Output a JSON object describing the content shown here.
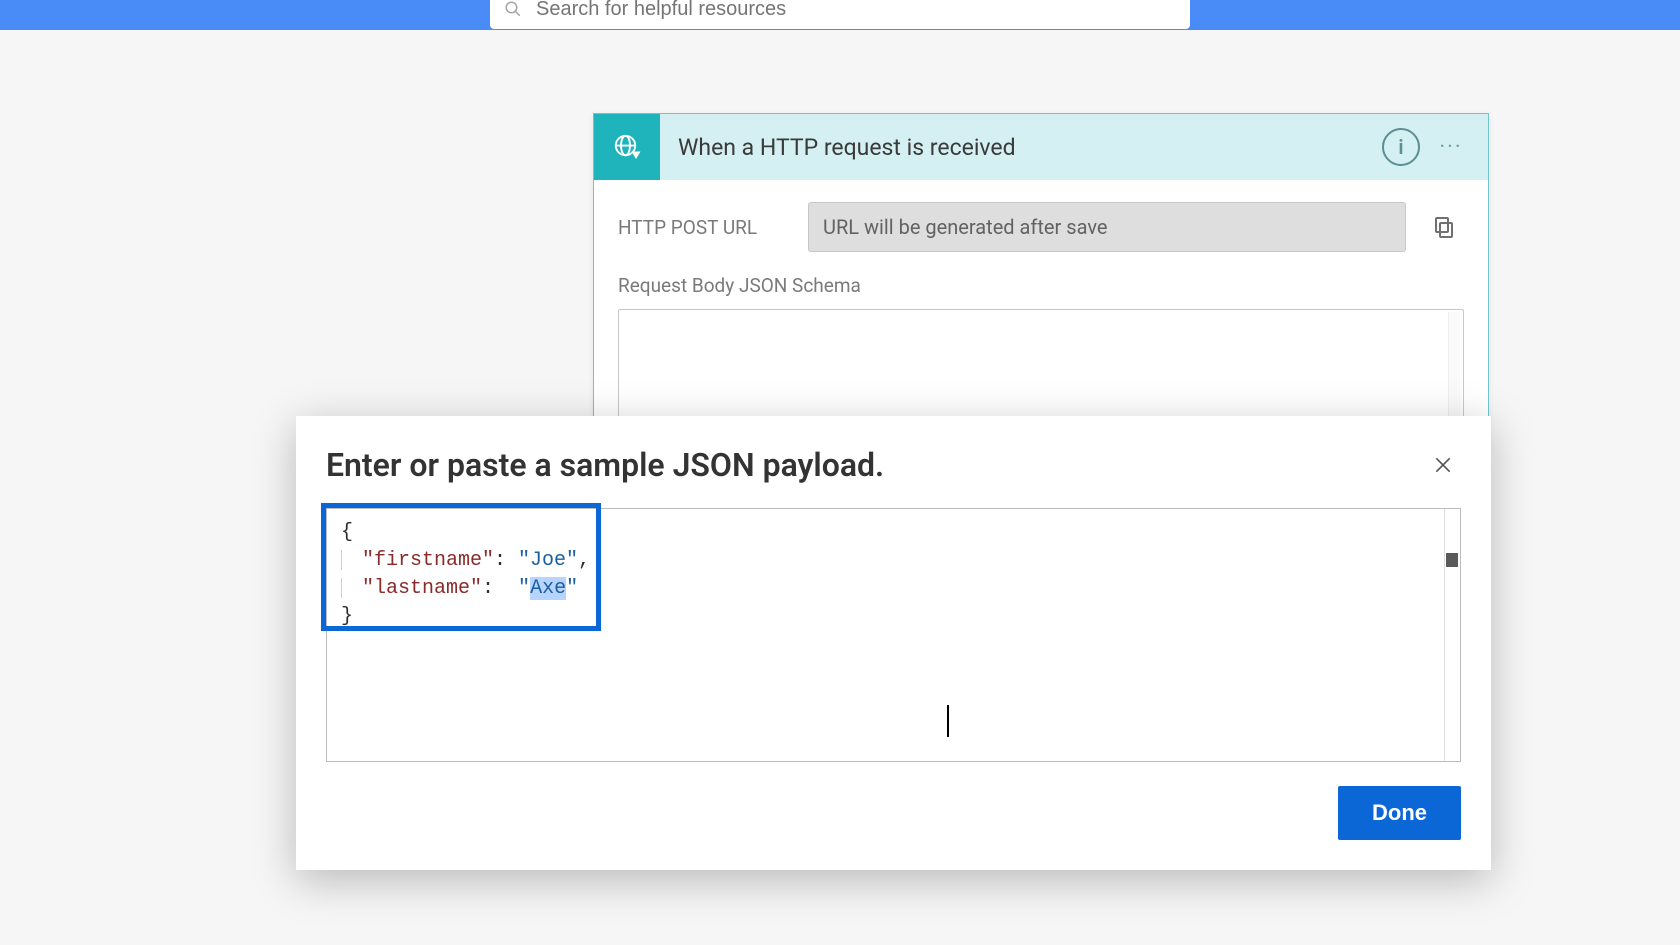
{
  "topbar": {
    "search_placeholder": "Search for helpful resources"
  },
  "trigger": {
    "title": "When a HTTP request is received",
    "url_label": "HTTP POST URL",
    "url_placeholder": "URL will be generated after save",
    "schema_label": "Request Body JSON Schema"
  },
  "modal": {
    "title": "Enter or paste a sample JSON payload.",
    "done_label": "Done",
    "sample_json": {
      "line1_open": "{",
      "line2_key": "\"firstname\"",
      "line2_sep": ": ",
      "line2_val": "\"Joe\"",
      "line2_trail": ",",
      "line3_key": "\"lastname\"",
      "line3_sep": ":  ",
      "line3_val_q1": "\"",
      "line3_val_sel": "Axe",
      "line3_val_q2": "\"",
      "line4_close": "}"
    }
  }
}
